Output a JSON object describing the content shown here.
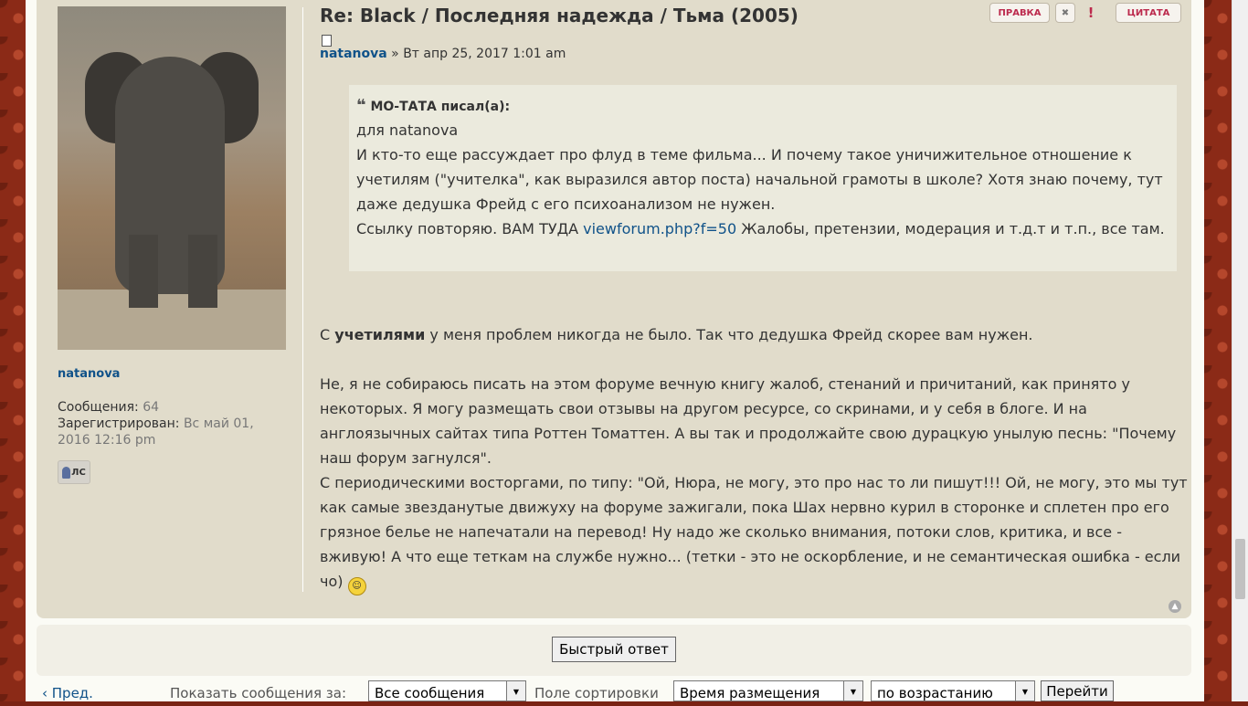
{
  "post": {
    "title": "Re: Black / Последняя надежда / Тьма (2005)",
    "author": "natanova",
    "separator": " » ",
    "date": "Вт апр 25, 2017 1:01 am",
    "actions": {
      "edit": "ПРАВКА",
      "delete": "✖",
      "report": "!",
      "quote": "ЦИТАТА"
    },
    "quote": {
      "header": "МО-ТАТА писал(а):",
      "lines": [
        "для natanova",
        "И кто-то еще рассуждает про флуд в теме фильма... И почему такое уничижительное отношение к учетилям (\"учителка\", как выразился автор поста) начальной грамоты в школе? Хотя знаю почему, тут даже дедушка Фрейд с его психоанализом не нужен."
      ],
      "link_prefix": "Ссылку повторяю. ВАМ ТУДА ",
      "link_text": "viewforum.php?f=50",
      "link_suffix": " Жалобы, претензии, модерация и т.д.т и т.п., все там."
    },
    "body": {
      "p1_pre": "С ",
      "p1_bold": "учетилями",
      "p1_post": " у меня проблем никогда не было. Так что дедушка Фрейд скорее вам нужен.",
      "p2": "Не, я не собираюсь писать на этом форуме вечную книгу жалоб, стенаний и причитаний, как принято у некоторых. Я могу размещать свои отзывы на другом ресурсе, со скринами, и у себя в блоге. И на англоязычных сайтах типа Роттен Томаттен. А вы так и продолжайте свою дурацкую унылую песнь: \"Почему наш форум загнулся\".",
      "p3": "С периодическими восторгами, по типу: \"Ой, Нюра, не могу, это про нас то ли пишут!!! Ой, не могу, это мы тут как самые звезданутые движуху на форуме зажигали, пока Шах нервно курил в сторонке и сплетен про его грязное белье не напечатали на перевод! Ну надо же сколько внимания, потоки слов, критика, и все - вживую! А что еще теткам на службе нужно... (тетки - это не оскорбление, и не семантическая ошибка - если чо)"
    }
  },
  "profile": {
    "username": "natanova",
    "posts_label": "Сообщения:",
    "posts_value": "64",
    "registered_label": "Зарегистрирован:",
    "registered_value": "Вс май 01, 2016 12:16 pm",
    "pm_label": "ЛС"
  },
  "quick_reply": {
    "label": "Быстрый ответ"
  },
  "bottom_bar": {
    "prev": "‹ Пред.",
    "show_label": "Показать сообщения за:",
    "show_value": "Все сообщения",
    "sort_label": "Поле сортировки",
    "sort_value": "Время размещения",
    "order_value": "по возрастанию",
    "go_label": "Перейти"
  }
}
